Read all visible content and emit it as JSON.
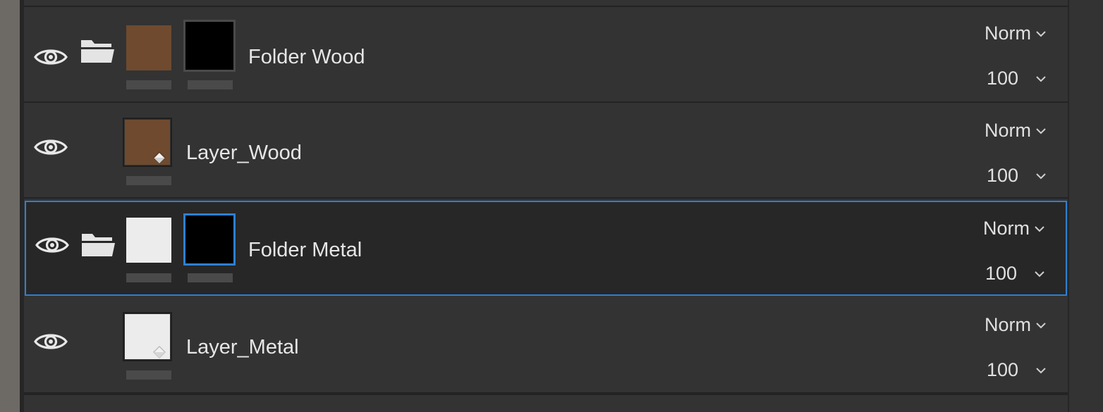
{
  "colors": {
    "accent": "#2f7fd1",
    "panel": "#333333",
    "selected_row": "#272727",
    "wood": "#6f4a2f",
    "metal": "#ececec"
  },
  "layers": [
    {
      "name": "Folder Wood",
      "type": "folder",
      "blend": "Norm",
      "opacity": "100",
      "visible": true,
      "selected": false,
      "fill": "wood"
    },
    {
      "name": "Layer_Wood",
      "type": "layer",
      "blend": "Norm",
      "opacity": "100",
      "visible": true,
      "selected": false,
      "fill": "wood"
    },
    {
      "name": "Folder Metal",
      "type": "folder",
      "blend": "Norm",
      "opacity": "100",
      "visible": true,
      "selected": true,
      "fill": "metal"
    },
    {
      "name": "Layer_Metal",
      "type": "layer",
      "blend": "Norm",
      "opacity": "100",
      "visible": true,
      "selected": false,
      "fill": "metal"
    }
  ],
  "icons": {
    "visibility": "eye-icon",
    "group": "folder-icon",
    "dropdown": "chevron-down-icon",
    "fill_layer": "paint-bucket-icon"
  }
}
